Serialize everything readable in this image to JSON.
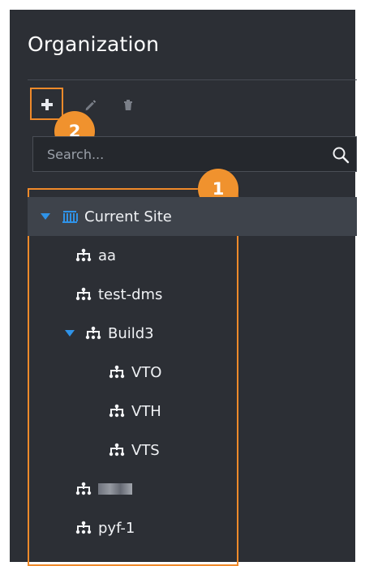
{
  "header": {
    "title": "Organization"
  },
  "toolbar": {
    "add_icon": "plus-icon",
    "edit_icon": "pencil-icon",
    "delete_icon": "trash-icon"
  },
  "search": {
    "placeholder": "Search..."
  },
  "callouts": {
    "one": "1",
    "two": "2"
  },
  "tree": {
    "items": [
      {
        "label": "Current Site",
        "expanded": true,
        "icon": "site-icon"
      },
      {
        "label": "aa",
        "icon": "org-unit-icon"
      },
      {
        "label": "test-dms",
        "icon": "org-unit-icon"
      },
      {
        "label": "Build3",
        "expanded": true,
        "icon": "org-unit-icon"
      },
      {
        "label": "VTO",
        "icon": "org-unit-icon"
      },
      {
        "label": "VTH",
        "icon": "org-unit-icon"
      },
      {
        "label": "VTS",
        "icon": "org-unit-icon"
      },
      {
        "label": "",
        "icon": "org-unit-icon"
      },
      {
        "label": "pyf-1",
        "icon": "org-unit-icon"
      }
    ]
  },
  "colors": {
    "accent": "#f08a2a",
    "caret": "#2f93e8",
    "panel": "#2c2f35"
  }
}
